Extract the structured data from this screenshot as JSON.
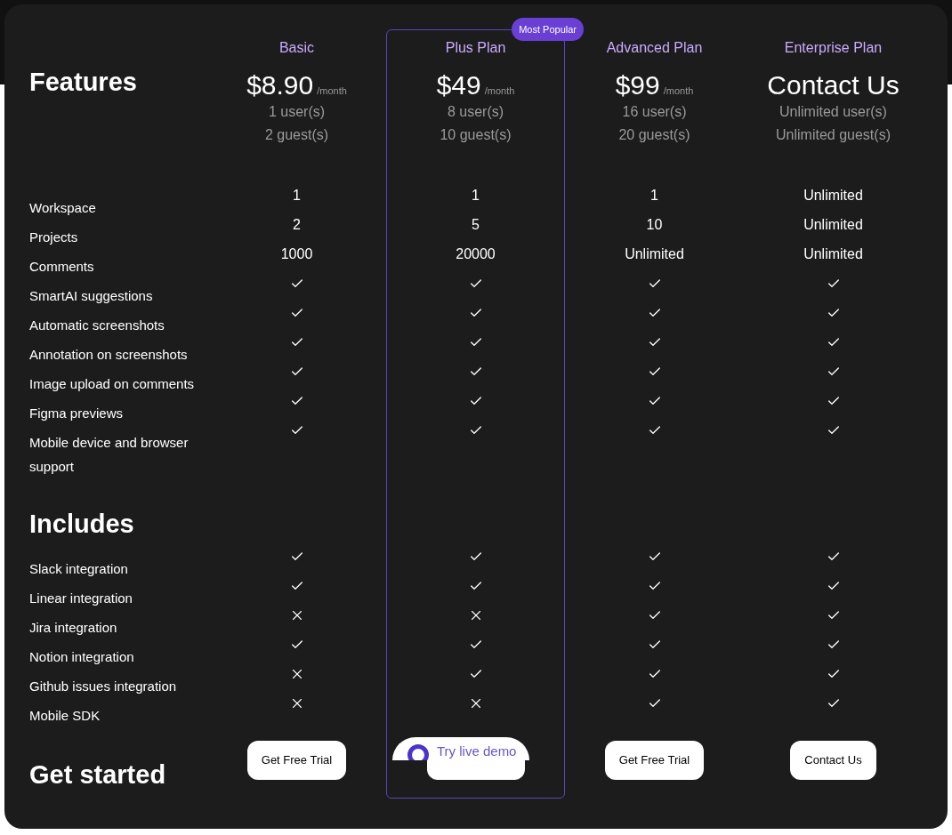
{
  "features_title": "Features",
  "plans": [
    {
      "name": "Basic",
      "price": "$8.90",
      "period": "/month",
      "users": "1 user(s)",
      "guests": "2 guest(s)",
      "highlighted": false,
      "button": "Get Free Trial"
    },
    {
      "name": "Plus Plan",
      "price": "$49",
      "period": "/month",
      "users": "8 user(s)",
      "guests": "10 guest(s)",
      "highlighted": true,
      "badge": "Most Popular"
    },
    {
      "name": "Advanced Plan",
      "price": "$99",
      "period": "/month",
      "users": "16 user(s)",
      "guests": "20 guest(s)",
      "highlighted": false,
      "button": "Get Free Trial"
    },
    {
      "name": "Enterprise Plan",
      "price": "Contact Us",
      "users": "Unlimited user(s)",
      "guests": "Unlimited guest(s)",
      "highlighted": false,
      "button": "Contact Us"
    }
  ],
  "features": [
    {
      "label": "Workspace",
      "cells": [
        {
          "kind": "text",
          "text": "1"
        },
        {
          "kind": "text",
          "text": "1"
        },
        {
          "kind": "text",
          "text": "1"
        },
        {
          "kind": "text",
          "text": "Unlimited"
        }
      ]
    },
    {
      "label": "Projects",
      "cells": [
        {
          "kind": "text",
          "text": "2"
        },
        {
          "kind": "text",
          "text": "5"
        },
        {
          "kind": "text",
          "text": "10"
        },
        {
          "kind": "text",
          "text": "Unlimited"
        }
      ]
    },
    {
      "label": "Comments",
      "cells": [
        {
          "kind": "text",
          "text": "1000"
        },
        {
          "kind": "text",
          "text": "20000"
        },
        {
          "kind": "text",
          "text": "Unlimited"
        },
        {
          "kind": "text",
          "text": "Unlimited"
        }
      ]
    },
    {
      "label": "SmartAI suggestions",
      "cells": [
        {
          "kind": "check"
        },
        {
          "kind": "check"
        },
        {
          "kind": "check"
        },
        {
          "kind": "check"
        }
      ]
    },
    {
      "label": "Automatic screenshots",
      "cells": [
        {
          "kind": "check"
        },
        {
          "kind": "check"
        },
        {
          "kind": "check"
        },
        {
          "kind": "check"
        }
      ]
    },
    {
      "label": "Annotation on screenshots",
      "cells": [
        {
          "kind": "check"
        },
        {
          "kind": "check"
        },
        {
          "kind": "check"
        },
        {
          "kind": "check"
        }
      ]
    },
    {
      "label": "Image upload on comments",
      "cells": [
        {
          "kind": "check"
        },
        {
          "kind": "check"
        },
        {
          "kind": "check"
        },
        {
          "kind": "check"
        }
      ]
    },
    {
      "label": "Figma previews",
      "cells": [
        {
          "kind": "check"
        },
        {
          "kind": "check"
        },
        {
          "kind": "check"
        },
        {
          "kind": "check"
        }
      ]
    },
    {
      "label": "Mobile device and browser support",
      "cells": [
        {
          "kind": "check"
        },
        {
          "kind": "check"
        },
        {
          "kind": "check"
        },
        {
          "kind": "check"
        }
      ]
    }
  ],
  "includes_title": "Includes",
  "includes": [
    {
      "label": "Slack integration",
      "cells": [
        {
          "kind": "check"
        },
        {
          "kind": "check"
        },
        {
          "kind": "check"
        },
        {
          "kind": "check"
        }
      ]
    },
    {
      "label": "Linear integration",
      "cells": [
        {
          "kind": "check"
        },
        {
          "kind": "check"
        },
        {
          "kind": "check"
        },
        {
          "kind": "check"
        }
      ]
    },
    {
      "label": "Jira integration",
      "cells": [
        {
          "kind": "cross"
        },
        {
          "kind": "cross"
        },
        {
          "kind": "check"
        },
        {
          "kind": "check"
        }
      ]
    },
    {
      "label": "Notion integration",
      "cells": [
        {
          "kind": "check"
        },
        {
          "kind": "check"
        },
        {
          "kind": "check"
        },
        {
          "kind": "check"
        }
      ]
    },
    {
      "label": "Github issues integration",
      "cells": [
        {
          "kind": "cross"
        },
        {
          "kind": "check"
        },
        {
          "kind": "check"
        },
        {
          "kind": "check"
        }
      ]
    },
    {
      "label": "Mobile SDK",
      "cells": [
        {
          "kind": "cross"
        },
        {
          "kind": "cross"
        },
        {
          "kind": "check"
        },
        {
          "kind": "check"
        }
      ]
    }
  ],
  "get_started_title": "Get started",
  "demo_widget": {
    "label": "Try live demo"
  }
}
